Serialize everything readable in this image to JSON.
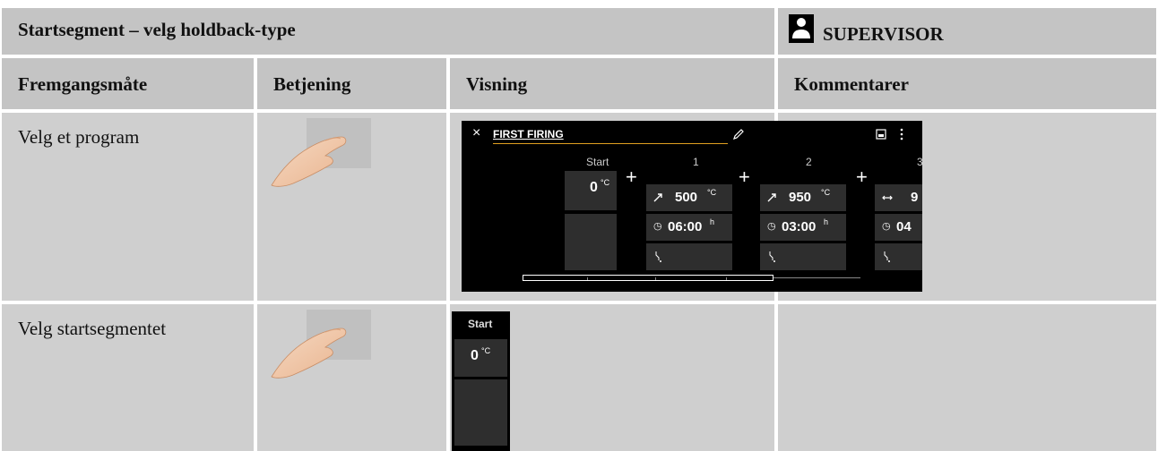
{
  "header": {
    "title": "Startsegment – velg holdback-type",
    "role": "SUPERVISOR",
    "role_icon": "user-icon"
  },
  "columns": [
    "Fremgangsmåte",
    "Betjening",
    "Visning",
    "Kommentarer"
  ],
  "rows": [
    {
      "step": "Velg et program",
      "operation_icon": "touch-hand-icon",
      "display": {
        "close_symbol": "×",
        "program_name": "FIRST FIRING",
        "edit_icon": "pencil-icon",
        "save_icon": "save-icon",
        "menu_icon": "more-vert-icon",
        "plus_symbol": "+",
        "segments": [
          {
            "label": "Start",
            "temp_value": "0",
            "temp_unit": "°C"
          },
          {
            "label": "1",
            "mode_icon": "ramp-up-icon",
            "mode_symbol": "↗",
            "temp_value": "500",
            "temp_unit": "°C",
            "time_value": "06:00",
            "time_unit": "h",
            "holdback_icon": "holdback-icon"
          },
          {
            "label": "2",
            "mode_icon": "ramp-up-icon",
            "mode_symbol": "↗",
            "temp_value": "950",
            "temp_unit": "°C",
            "time_value": "03:00",
            "time_unit": "h",
            "holdback_icon": "holdback-icon"
          },
          {
            "label": "3",
            "mode_icon": "dwell-icon",
            "mode_symbol": "↔",
            "temp_value": "9",
            "time_value": "04"
          }
        ]
      },
      "comment": ""
    },
    {
      "step": "Velg startsegmentet",
      "operation_icon": "touch-hand-icon",
      "display": {
        "label": "Start",
        "temp_value": "0",
        "temp_unit": "°C"
      },
      "comment": ""
    }
  ]
}
